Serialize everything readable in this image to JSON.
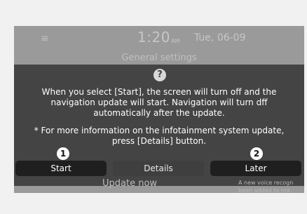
{
  "background": {
    "menu_icon": "≡",
    "time": "1:20",
    "ampm": "AM",
    "date": "Tue, 06-09",
    "title": "General settings",
    "update_now": "Update now",
    "voice_note_line1": "A new voice recogn",
    "voice_note_line2": "been added to ma"
  },
  "popup": {
    "icon": "?",
    "message_line1": "When you select [Start], the screen will turn off and the",
    "message_line2": "navigation update will start. Navigation will turn dff",
    "message_line3": "automatically after the update.",
    "info_line1": "* For more information on the infotainment system update,",
    "info_line2": "press [Details] button.",
    "buttons": {
      "start": "Start",
      "details": "Details",
      "later": "Later"
    }
  },
  "callouts": {
    "one": "1",
    "two": "2"
  },
  "colors": {
    "popup_bg": "#444444",
    "button_dark": "#1f1f1f",
    "button_mid": "#3f3f3f",
    "screen_dim": "#9a9a9a"
  }
}
